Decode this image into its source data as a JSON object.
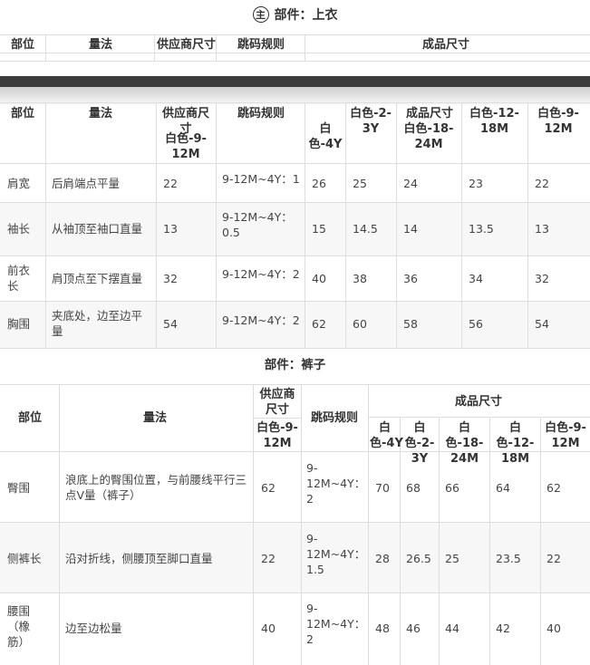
{
  "top_title": {
    "badge": "主",
    "text": "部件：上衣"
  },
  "top_header": {
    "part": "部位",
    "method": "量法",
    "supplier": "供应商尺寸",
    "jump": "跳码规则",
    "finished": "成品尺寸"
  },
  "shirt": {
    "header": {
      "part": "部位",
      "method": "量法",
      "supplier": "供应商尺寸",
      "supplier_size": "白色-9-12M",
      "jump": "跳码规则",
      "finished": "成品尺寸",
      "sizes": [
        "白色-4Y",
        "白色-2-3Y",
        "白色-18-24M",
        "白色-12-18M",
        "白色-9-12M"
      ]
    },
    "rows": [
      {
        "part": "肩宽",
        "method": "后肩端点平量",
        "supplier": "22",
        "jump": "9-12M~4Y：1",
        "values": [
          "26",
          "25",
          "24",
          "23",
          "22"
        ]
      },
      {
        "part": "袖长",
        "method": "从袖顶至袖口直量",
        "supplier": "13",
        "jump": "9-12M~4Y：0.5",
        "values": [
          "15",
          "14.5",
          "14",
          "13.5",
          "13"
        ]
      },
      {
        "part": "前衣长",
        "method": "肩顶点至下摆直量",
        "supplier": "32",
        "jump": "9-12M~4Y：2",
        "values": [
          "40",
          "38",
          "36",
          "34",
          "32"
        ]
      },
      {
        "part": "胸围",
        "method": "夹底处，边至边平量",
        "supplier": "54",
        "jump": "9-12M~4Y：2",
        "values": [
          "62",
          "60",
          "58",
          "56",
          "54"
        ]
      }
    ]
  },
  "pants": {
    "title": "部件：裤子",
    "header": {
      "part": "部位",
      "method": "量法",
      "supplier": "供应商尺寸",
      "supplier_size": "白色-9-12M",
      "jump": "跳码规则",
      "finished": "成品尺寸",
      "sizes": [
        "白色-4Y",
        "白色-2-3Y",
        "白色-18-24M",
        "白色-12-18M",
        "白色-9-12M"
      ]
    },
    "rows": [
      {
        "part": "臀围",
        "method": "浪底上的臀围位置，与前腰线平行三点V量（裤子）",
        "supplier": "62",
        "jump": "9-12M~4Y：2",
        "values": [
          "70",
          "68",
          "66",
          "64",
          "62"
        ]
      },
      {
        "part": "侧裤长",
        "method": "沿对折线，侧腰顶至脚口直量",
        "supplier": "22",
        "jump": "9-12M~4Y：1.5",
        "values": [
          "28",
          "26.5",
          "25",
          "23.5",
          "22"
        ]
      },
      {
        "part": "腰围（橡筋）",
        "method": "边至边松量",
        "supplier": "40",
        "jump": "9-12M~4Y：2",
        "values": [
          "48",
          "46",
          "44",
          "42",
          "40"
        ]
      }
    ]
  }
}
